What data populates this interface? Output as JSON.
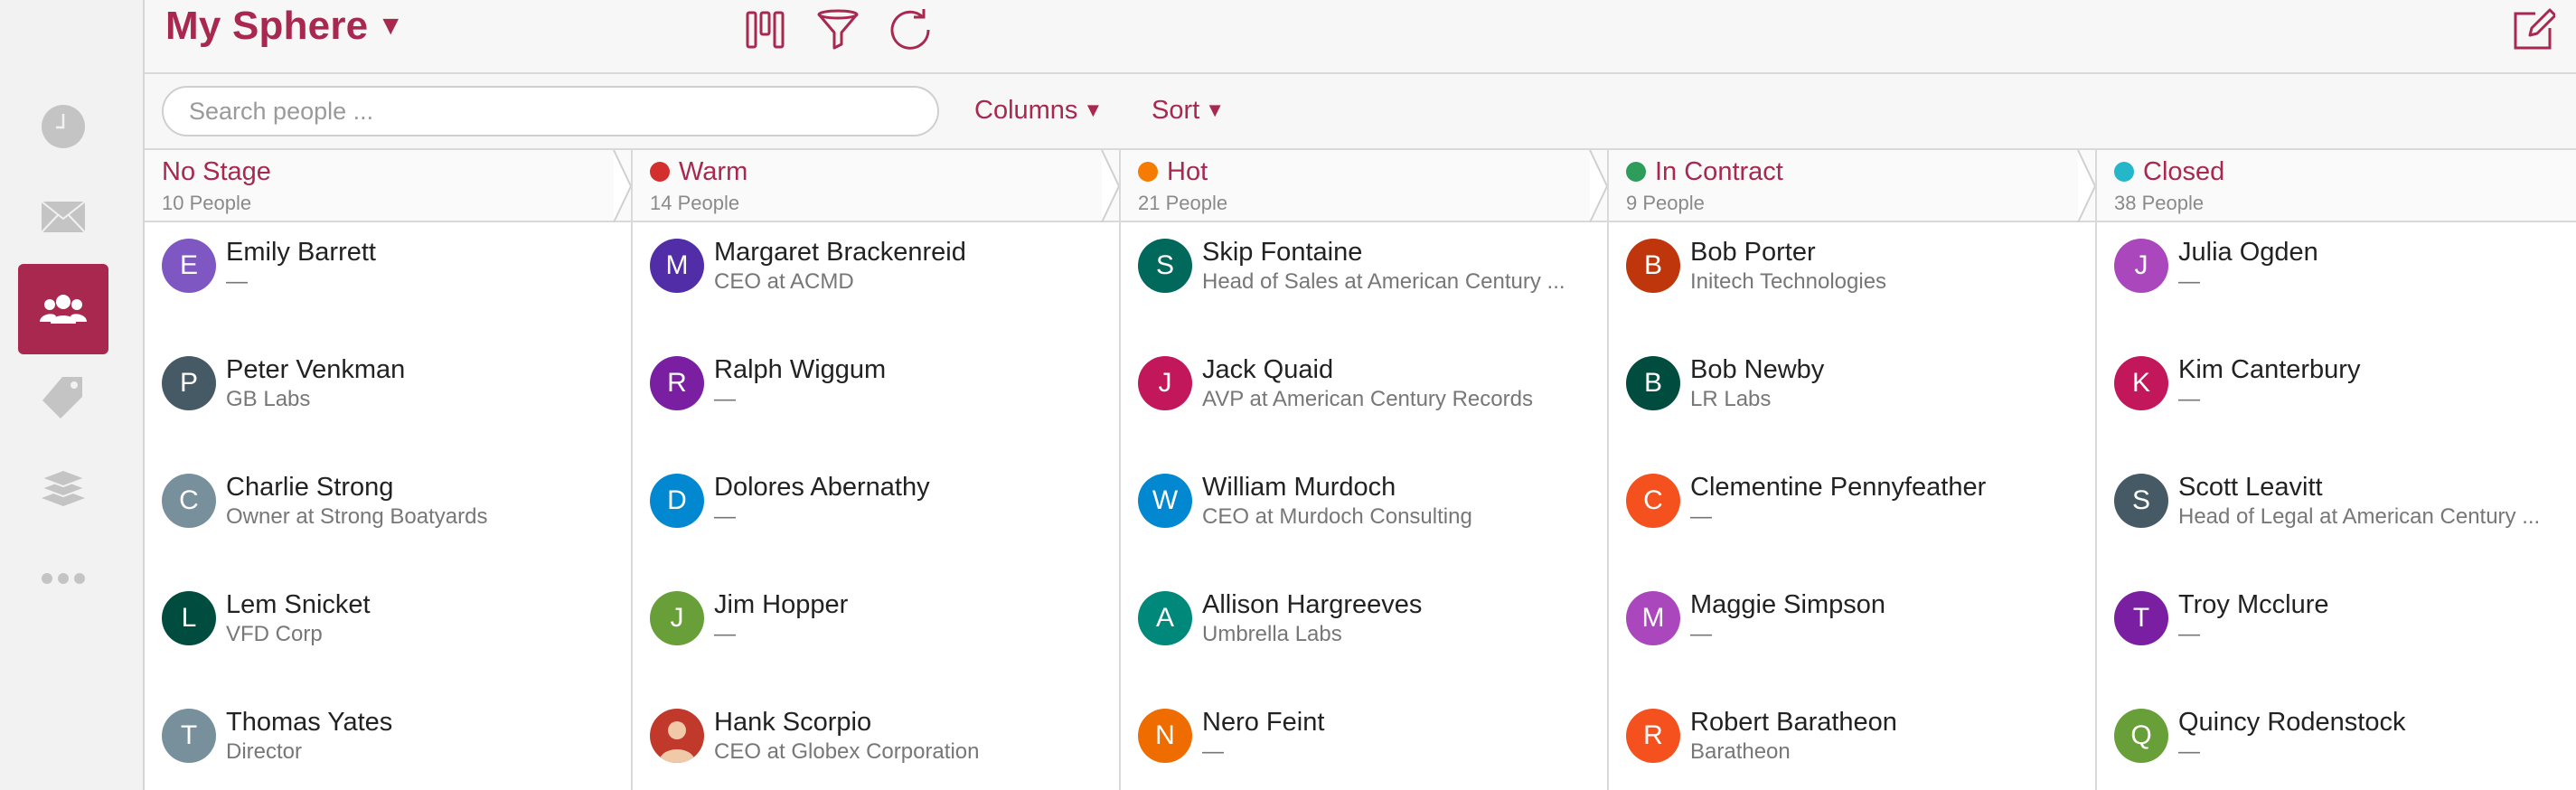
{
  "app": {
    "title": "My Sphere"
  },
  "sidebar": {
    "items": [
      {
        "icon": "clock-icon",
        "active": false
      },
      {
        "icon": "mail-icon",
        "active": false
      },
      {
        "icon": "people-icon",
        "active": true
      },
      {
        "icon": "tag-icon",
        "active": false
      },
      {
        "icon": "layers-icon",
        "active": false
      },
      {
        "icon": "more-icon",
        "active": false
      }
    ]
  },
  "toolbar": {
    "icons": [
      "columns-icon",
      "filter-icon",
      "refresh-icon",
      "compose-icon"
    ]
  },
  "filters": {
    "search_placeholder": "Search people ...",
    "columns_label": "Columns",
    "sort_label": "Sort"
  },
  "colors": {
    "accent": "#a8284f"
  },
  "stages": [
    {
      "name": "No Stage",
      "count": "10 People",
      "dot": null,
      "people": [
        {
          "initial": "E",
          "name": "Emily Barrett",
          "sub": "—",
          "color": "#7e57c2"
        },
        {
          "initial": "P",
          "name": "Peter Venkman",
          "sub": "GB Labs",
          "color": "#455a64"
        },
        {
          "initial": "C",
          "name": "Charlie Strong",
          "sub": "Owner at Strong Boatyards",
          "color": "#78909c"
        },
        {
          "initial": "L",
          "name": "Lem Snicket",
          "sub": "VFD Corp",
          "color": "#004d40"
        },
        {
          "initial": "T",
          "name": "Thomas Yates",
          "sub": "Director",
          "color": "#78909c"
        }
      ]
    },
    {
      "name": "Warm",
      "count": "14 People",
      "dot": "#d32f2f",
      "people": [
        {
          "initial": "M",
          "name": "Margaret Brackenreid",
          "sub": "CEO at ACMD",
          "color": "#512da8"
        },
        {
          "initial": "R",
          "name": "Ralph Wiggum",
          "sub": "—",
          "color": "#7b1fa2"
        },
        {
          "initial": "D",
          "name": "Dolores Abernathy",
          "sub": "—",
          "color": "#0288d1"
        },
        {
          "initial": "J",
          "name": "Jim Hopper",
          "sub": "—",
          "color": "#689f38"
        },
        {
          "initial": "",
          "name": "Hank Scorpio",
          "sub": "CEO at Globex Corporation",
          "color": "#c0392b",
          "photo": true
        }
      ]
    },
    {
      "name": "Hot",
      "count": "21 People",
      "dot": "#f57c00",
      "people": [
        {
          "initial": "S",
          "name": "Skip Fontaine",
          "sub": "Head of Sales at American Century ...",
          "color": "#00695c"
        },
        {
          "initial": "J",
          "name": "Jack Quaid",
          "sub": "AVP at American Century Records",
          "color": "#c2185b"
        },
        {
          "initial": "W",
          "name": "William Murdoch",
          "sub": "CEO at Murdoch Consulting",
          "color": "#0288d1"
        },
        {
          "initial": "A",
          "name": "Allison Hargreeves",
          "sub": "Umbrella Labs",
          "color": "#00897b"
        },
        {
          "initial": "N",
          "name": "Nero Feint",
          "sub": "—",
          "color": "#ef6c00"
        }
      ]
    },
    {
      "name": "In Contract",
      "count": "9 People",
      "dot": "#2e9d5b",
      "people": [
        {
          "initial": "B",
          "name": "Bob Porter",
          "sub": "Initech Technologies",
          "color": "#bf360c"
        },
        {
          "initial": "B",
          "name": "Bob Newby",
          "sub": "LR Labs",
          "color": "#004d40"
        },
        {
          "initial": "C",
          "name": "Clementine Pennyfeather",
          "sub": "—",
          "color": "#f4511e"
        },
        {
          "initial": "M",
          "name": "Maggie Simpson",
          "sub": "—",
          "color": "#ab47bc"
        },
        {
          "initial": "R",
          "name": "Robert Baratheon",
          "sub": "Baratheon",
          "color": "#f4511e"
        }
      ]
    },
    {
      "name": "Closed",
      "count": "38 People",
      "dot": "#26b6c9",
      "people": [
        {
          "initial": "J",
          "name": "Julia Ogden",
          "sub": "—",
          "color": "#ab47bc"
        },
        {
          "initial": "K",
          "name": "Kim Canterbury",
          "sub": "—",
          "color": "#c2185b"
        },
        {
          "initial": "S",
          "name": "Scott Leavitt",
          "sub": "Head of Legal at American Century ...",
          "color": "#455a64"
        },
        {
          "initial": "T",
          "name": "Troy Mcclure",
          "sub": "—",
          "color": "#7b1fa2"
        },
        {
          "initial": "Q",
          "name": "Quincy Rodenstock",
          "sub": "—",
          "color": "#689f38"
        }
      ]
    }
  ]
}
